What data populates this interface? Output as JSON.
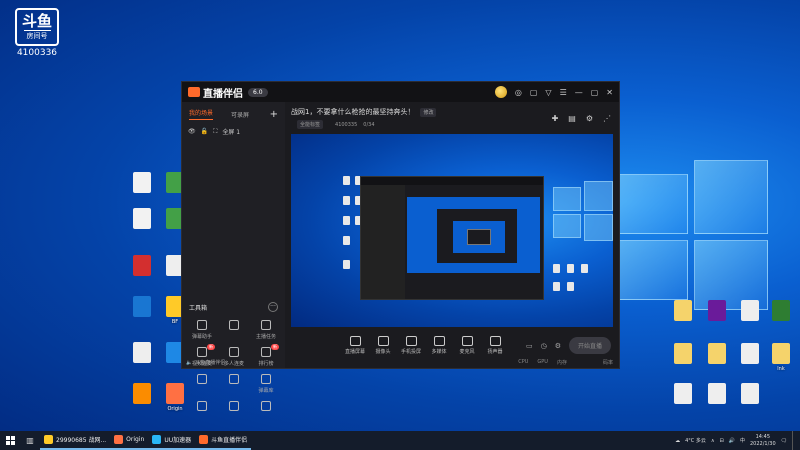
{
  "desktop": {
    "brand_logo_text": "斗鱼",
    "brand_logo_sub": "房间号",
    "room_id": "4100336",
    "icons_left": [
      {
        "label": "",
        "color": "#f2f2f2"
      },
      {
        "label": "",
        "color": "#43a047"
      },
      {
        "label": "",
        "color": "#f2f2f2"
      },
      {
        "label": "",
        "color": "#43a047"
      },
      {
        "label": "",
        "color": "#d32f2f"
      },
      {
        "label": "",
        "color": "#eeeeee"
      },
      {
        "label": "",
        "color": "#1976d2"
      },
      {
        "label": "BF",
        "color": "#ffca28"
      },
      {
        "label": "",
        "color": "#eeeeee"
      },
      {
        "label": "",
        "color": "#1e88e5"
      },
      {
        "label": "",
        "color": "#fb8c00"
      },
      {
        "label": "Origin",
        "color": "#ff7043"
      }
    ],
    "icons_right": [
      {
        "label": "",
        "color": "#f5d36b"
      },
      {
        "label": "",
        "color": "#6a1b9a"
      },
      {
        "label": "",
        "color": "#eeeeee"
      },
      {
        "label": "",
        "color": "#2e7d32"
      },
      {
        "label": "",
        "color": "#f5d36b"
      },
      {
        "label": "",
        "color": "#f5d36b"
      },
      {
        "label": "",
        "color": "#eeeeee"
      },
      {
        "label": "lnk",
        "color": "#f5d36b"
      },
      {
        "label": "",
        "color": "#eeeeee"
      },
      {
        "label": "",
        "color": "#eeeeee"
      },
      {
        "label": "",
        "color": "#eeeeee"
      }
    ]
  },
  "app": {
    "name": "直播伴侣",
    "version": "6.0",
    "titlebar_icons": [
      "◎",
      "▢",
      "▽",
      "☰",
      "—",
      "▢",
      "✕"
    ],
    "tabs": [
      "我的场景",
      "",
      "可录屏"
    ],
    "tab_add": "+",
    "scene_name": "全屏 1",
    "tools_title": "工具箱",
    "tools_more": "···",
    "tools": [
      {
        "label": "弹幕助手",
        "badge": ""
      },
      {
        "label": "",
        "badge": ""
      },
      {
        "label": "主播任务",
        "badge": ""
      },
      {
        "label": "视频连麦",
        "badge": "新"
      },
      {
        "label": "多人连麦",
        "badge": ""
      },
      {
        "label": "排行榜",
        "badge": "新"
      },
      {
        "label": "",
        "badge": ""
      },
      {
        "label": "",
        "badge": ""
      },
      {
        "label": "弹幕库",
        "badge": ""
      },
      {
        "label": "",
        "badge": ""
      },
      {
        "label": "",
        "badge": ""
      },
      {
        "label": "",
        "badge": ""
      }
    ],
    "notice_icon": "🔈",
    "notice_text": "斗鱼直播伴侣",
    "room_title": "战网1，不要拿什么枪抢的最坚持奔头！",
    "room_title_edit": "修改",
    "room_info": [
      "",
      "全能标签",
      "",
      "4100335",
      "0/34"
    ],
    "main_icons": [
      "✚",
      "▤",
      "⚙",
      "⋰"
    ],
    "controls": [
      {
        "label": "直播屏幕"
      },
      {
        "label": "摄像头"
      },
      {
        "label": "手机投屏"
      },
      {
        "label": "多媒体"
      },
      {
        "label": "麦克风"
      },
      {
        "label": "扬声器"
      }
    ],
    "start_live": "开始直播",
    "status": [
      "CPU",
      "GPU",
      "内存",
      "",
      "",
      "",
      "码率"
    ]
  },
  "taskbar": {
    "tasks": [
      {
        "label": "29990685 战网...",
        "color": "#ffca28"
      },
      {
        "label": "Origin",
        "color": "#ff7043"
      },
      {
        "label": "UU加速器",
        "color": "#29b6f6"
      },
      {
        "label": "斗鱼直播伴侣",
        "color": "#ff6a2b"
      }
    ],
    "weather": "4°C 多云",
    "tray_icons": [
      "∧",
      "⊟",
      "🔊",
      "中"
    ],
    "time": "14:45",
    "date": "2022/1/30"
  }
}
